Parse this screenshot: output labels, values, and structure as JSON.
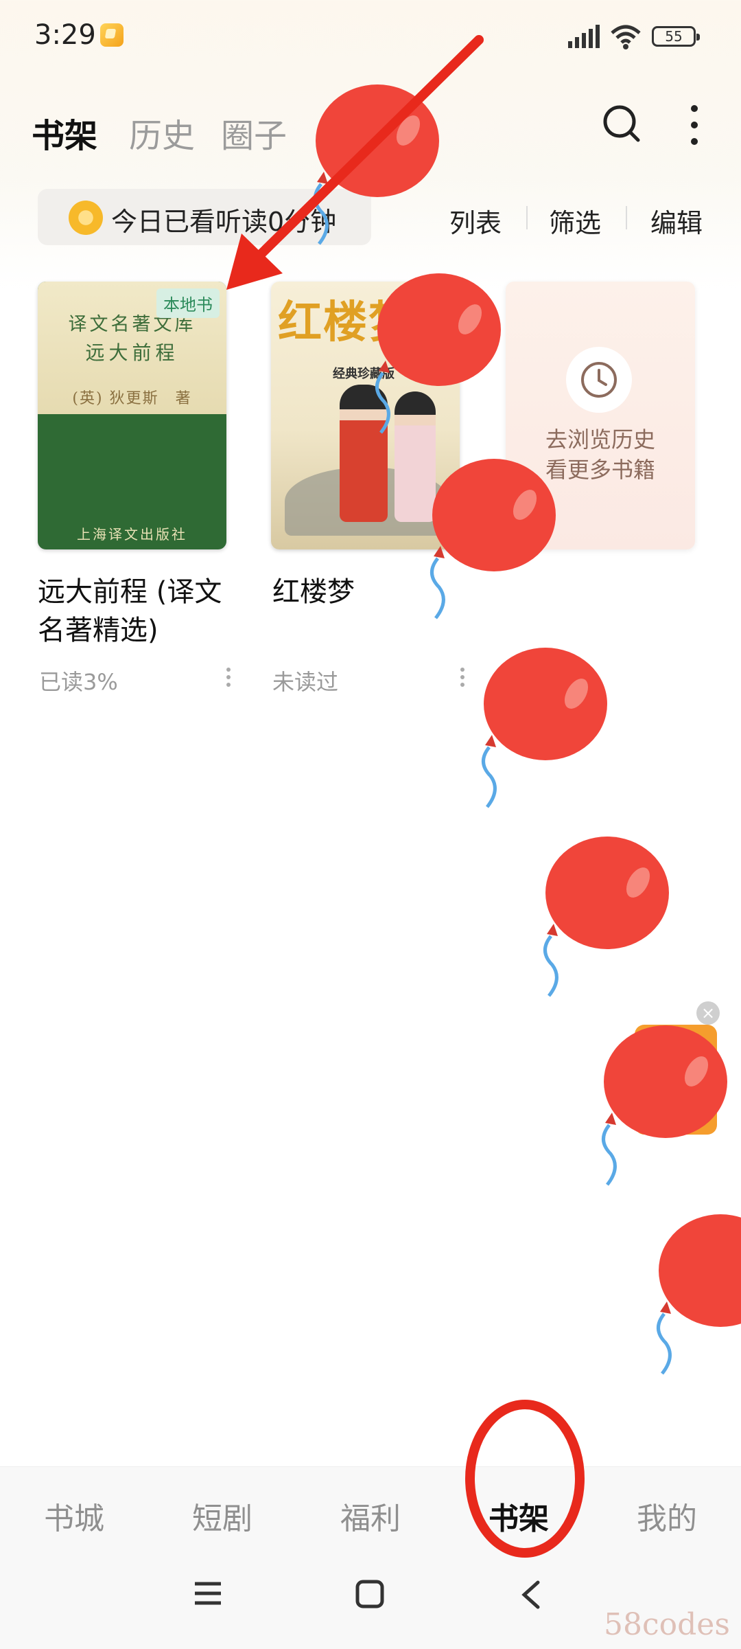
{
  "status": {
    "time": "3:29",
    "battery": "55"
  },
  "header": {
    "tabs": [
      "书架",
      "历史",
      "圈子"
    ],
    "active_tab": "书架"
  },
  "toolbar": {
    "reading_time": "今日已看听读0分钟",
    "list": "列表",
    "filter": "筛选",
    "edit": "编辑"
  },
  "books": [
    {
      "title": "远大前程 (译文名著精选)",
      "progress": "已读3%",
      "badge": "本地书",
      "cover": {
        "series": "译文名著文库",
        "title": "远大前程",
        "author": "(英) 狄更斯　著",
        "publisher": "上海译文出版社"
      }
    },
    {
      "title": "红楼梦",
      "progress": "未读过",
      "cover": {
        "title": "红楼梦",
        "subtitle": "经典珍藏版"
      }
    }
  ],
  "history_card": {
    "line1": "去浏览历史",
    "line2": "看更多书籍"
  },
  "bottom_nav": {
    "items": [
      "书城",
      "短剧",
      "福利",
      "书架",
      "我的"
    ],
    "active": "书架"
  },
  "watermark": "58codes",
  "colors": {
    "annotation_red": "#e8291c",
    "balloon_red": "#f0453a",
    "local_badge_green": "#2b8a5a"
  },
  "icons": [
    "search-icon",
    "more-icon",
    "coin-icon",
    "clock-icon",
    "menu-icon",
    "home-icon",
    "back-icon",
    "close-icon"
  ]
}
